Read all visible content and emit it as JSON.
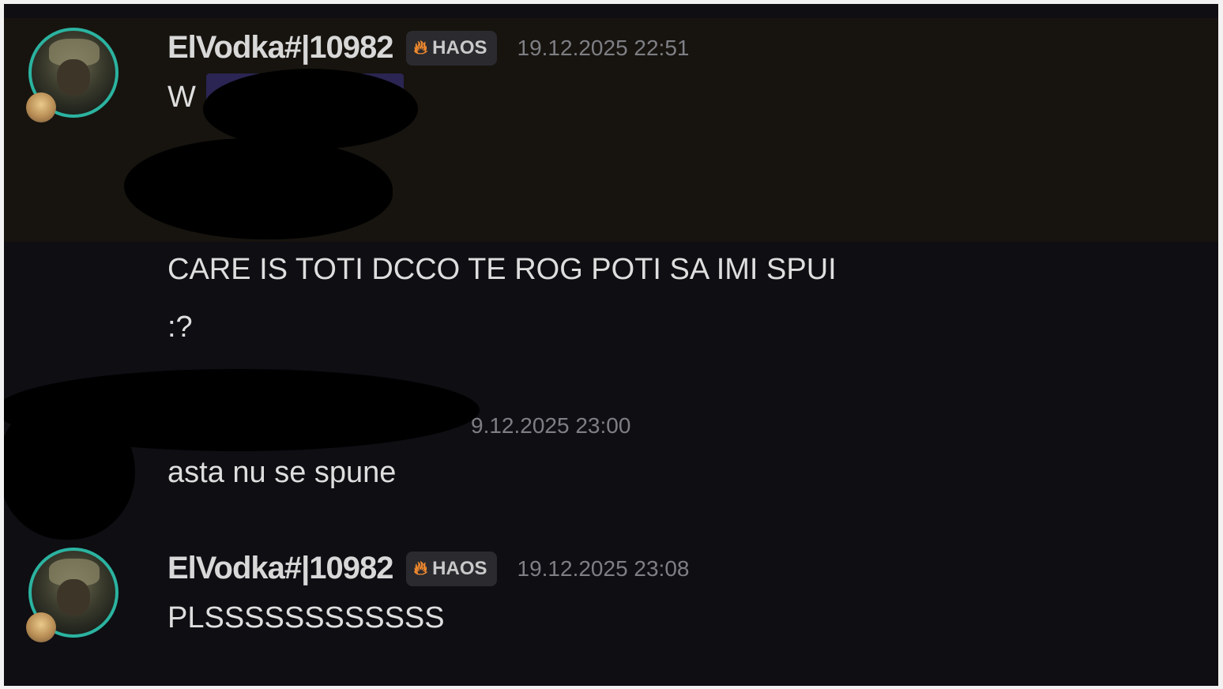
{
  "messages": [
    {
      "username": "ElVodka#|10982",
      "tag": "HAOS",
      "timestamp": "19.12.2025 22:51",
      "lines": [
        "W"
      ]
    },
    {
      "lines": [
        "CARE IS TOTI DCCO TE ROG POTI SA IMI SPUI",
        ":?"
      ]
    },
    {
      "timestamp_visible": "9.12.2025 23:00",
      "lines": [
        "asta nu se spune"
      ]
    },
    {
      "username": "ElVodka#|10982",
      "tag": "HAOS",
      "timestamp": "19.12.2025 23:08",
      "lines": [
        "PLSSSSSSSSSSSS"
      ]
    }
  ],
  "icons": {
    "tag_icon": "flame-icon",
    "avatar_decoration": "cat-face-icon"
  },
  "colors": {
    "background": "#0e0e13",
    "highlight": "#17140f",
    "avatar_ring": "#2bb3a0",
    "tag_flame": "#f0892f",
    "username": "#d8d8d8",
    "timestamp": "#7e7e84"
  }
}
